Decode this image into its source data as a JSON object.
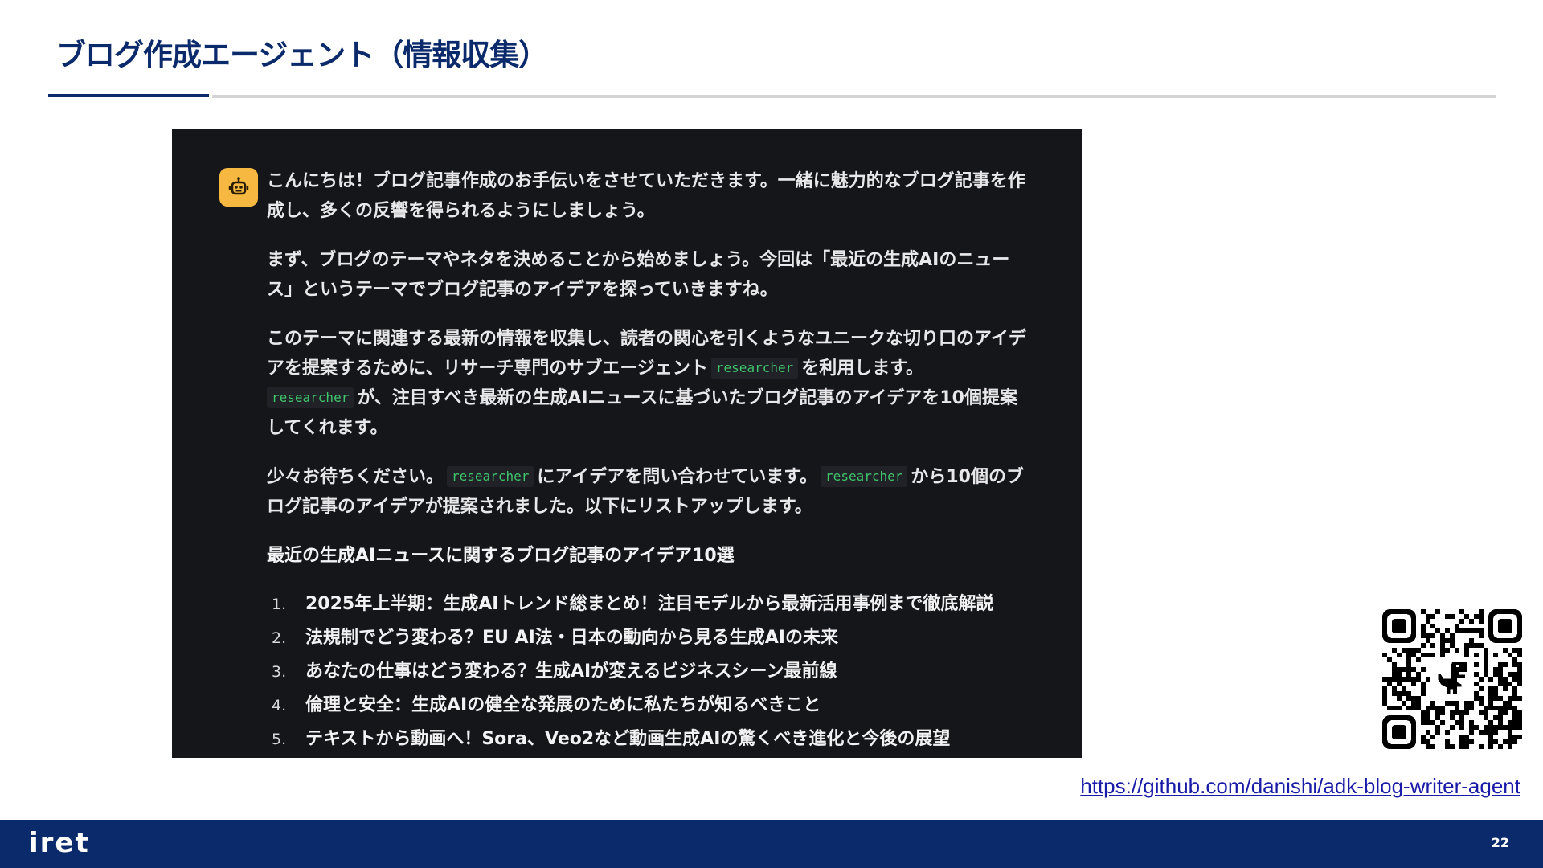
{
  "slide": {
    "title": "ブログ作成エージェント（情報収集）",
    "repo_link": "https://github.com/danishi/adk-blog-writer-agent",
    "page_number": "22",
    "footer_logo": "iret"
  },
  "colors": {
    "brand_navy": "#0b2a6b",
    "chat_background": "#151619",
    "bot_avatar": "#f6b840",
    "code_text": "#3fc56b"
  },
  "chat": {
    "avatar_icon": "robot-icon",
    "agent_name": "researcher",
    "p1": "こんにちは！ブログ記事作成のお手伝いをさせていただきます。一緒に魅力的なブログ記事を作成し、多くの反響を得られるようにしましょう。",
    "p2": "まず、ブログのテーマやネタを決めることから始めましょう。今回は「最近の生成AIのニュース」というテーマでブログ記事のアイデアを探っていきますね。",
    "p3_a": "このテーマに関連する最新の情報を収集し、読者の関心を引くようなユニークな切り口のアイデアを提案するために、リサーチ専門のサブエージェント",
    "p3_b": "を利用します。",
    "p3_c": "が、注目すべき最新の生成AIニュースに基づいたブログ記事のアイデアを10個提案してくれます。",
    "p4_a": "少々お待ちください。",
    "p4_b": "にアイデアを問い合わせています。",
    "p4_c": "から10個のブログ記事のアイデアが提案されました。以下にリストアップします。",
    "heading": "最近の生成AIニュースに関するブログ記事のアイデア10選",
    "ideas": [
      {
        "num": "1.",
        "text": "2025年上半期：生成AIトレンド総まとめ！注目モデルから最新活用事例まで徹底解説"
      },
      {
        "num": "2.",
        "text": "法規制でどう変わる？EU AI法・日本の動向から見る生成AIの未来"
      },
      {
        "num": "3.",
        "text": "あなたの仕事はどう変わる？生成AIが変えるビジネスシーン最前線"
      },
      {
        "num": "4.",
        "text": "倫理と安全：生成AIの健全な発展のために私たちが知るべきこと"
      },
      {
        "num": "5.",
        "text": "テキストから動画へ！Sora、Veo2など動画生成AIの驚くべき進化と今後の展望"
      }
    ]
  },
  "qr": {
    "icon": "qr-code-icon",
    "center_icon": "dinosaur-icon"
  }
}
